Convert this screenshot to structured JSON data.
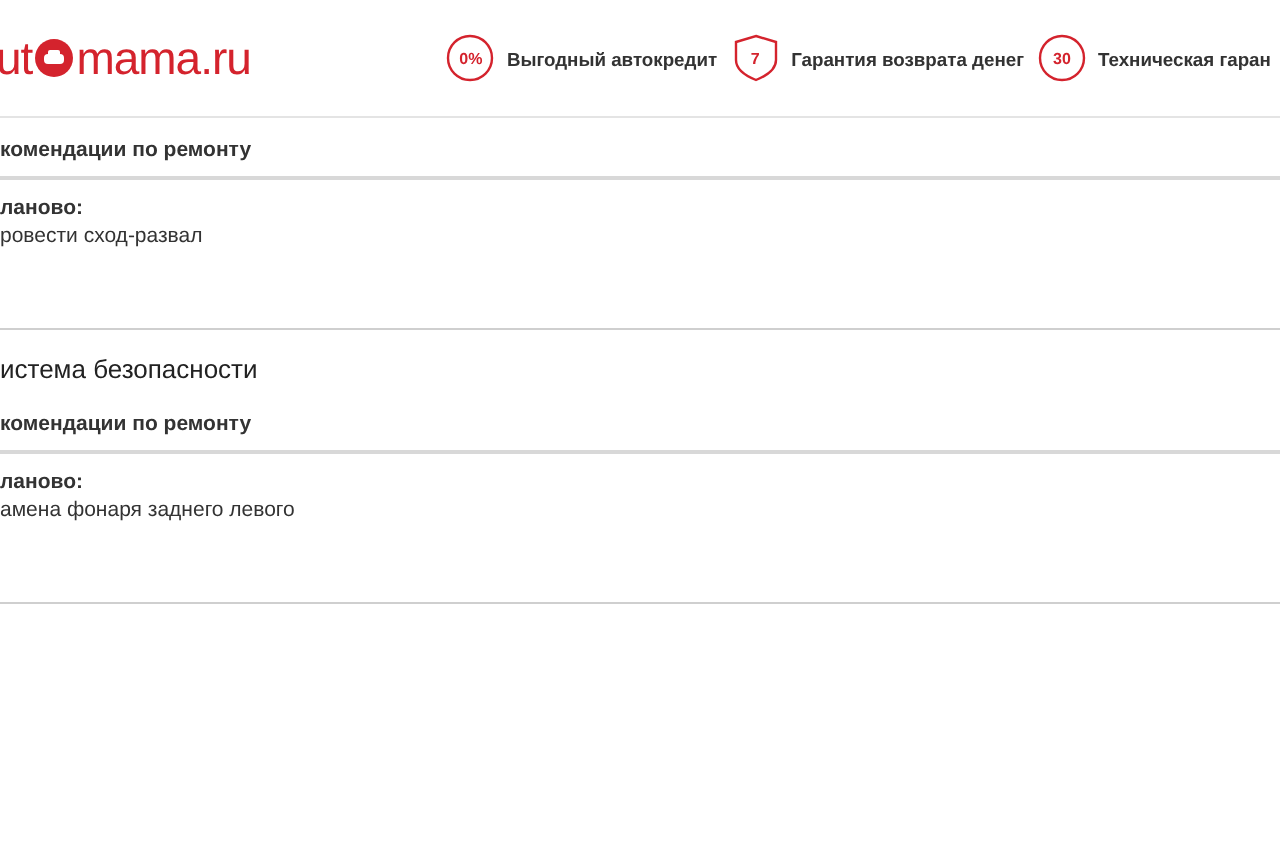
{
  "header": {
    "logo": {
      "before": "ut",
      "after": "mama.ru"
    },
    "features": [
      {
        "kind": "circle",
        "badge": "0%",
        "label": "Выгодный автокредит"
      },
      {
        "kind": "shield",
        "badge": "7",
        "label": "Гарантия возврата денег"
      },
      {
        "kind": "circle",
        "badge": "30",
        "label": "Техническая гаран"
      }
    ]
  },
  "sections": [
    {
      "subheading": "комендации по ремонту",
      "status": "ланово:",
      "item": "ровести сход-развал"
    },
    {
      "title": "истема безопасности",
      "subheading": "комендации по ремонту",
      "status": "ланово:",
      "item": "амена фонаря заднего левого"
    }
  ]
}
